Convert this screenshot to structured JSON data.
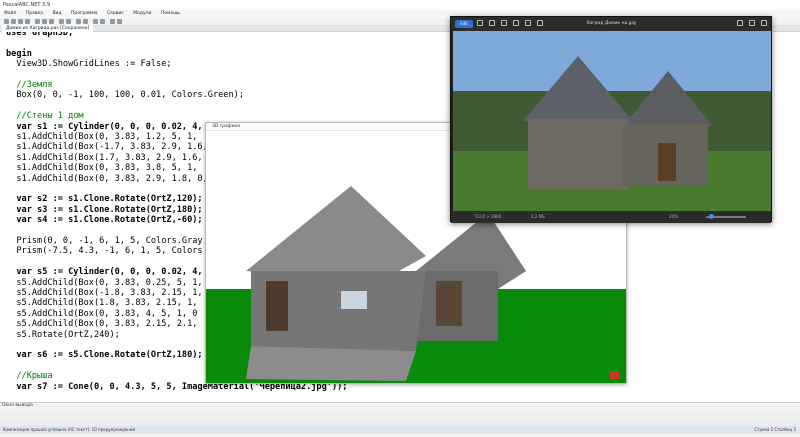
{
  "ide": {
    "title": "PascalABC.NET 3.9",
    "menu": [
      "Файл",
      "Правка",
      "Вид",
      "Программа",
      "Сервис",
      "Модули",
      "Помощь"
    ],
    "file_tab": "Домик из Хагрида.pas [Сохранено]"
  },
  "code": {
    "lines": [
      "uses Graph3D;",
      "",
      "begin",
      "  View3D.ShowGridLines := False;",
      "",
      "  //Земля",
      "  Box(0, 0, -1, 100, 100, 0.01, Colors.Green);",
      "",
      "  //Стены 1 дом",
      "  var s1 := Cylinder(0, 0, 0, 0.02, 4,",
      "  s1.AddChild(Box(0, 3.83, 1.2, 5, 1,",
      "  s1.AddChild(Box(-1.7, 3.83, 2.9, 1.6,",
      "  s1.AddChild(Box(1.7, 3.83, 2.9, 1.6,",
      "  s1.AddChild(Box(0, 3.83, 3.8, 5, 1,",
      "  s1.AddChild(Box(0, 3.83, 2.9, 1.8, 0,",
      "",
      "  var s2 := s1.Clone.Rotate(OrtZ,120);",
      "  var s3 := s1.Clone.Rotate(OrtZ,180);",
      "  var s4 := s1.Clone.Rotate(OrtZ,-60);",
      "",
      "  Prism(0, 0, -1, 6, 1, 5, Colors.Gray",
      "  Prism(-7.5, 4.3, -1, 6, 1, 5, Colors",
      "",
      "  var s5 := Cylinder(0, 0, 0, 0.02, 4,",
      "  s5.AddChild(Box(0, 3.83, 0.25, 5, 1,",
      "  s5.AddChild(Box(-1.8, 3.83, 2.15, 1,",
      "  s5.AddChild(Box(1.8, 3.83, 2.15, 1,",
      "  s5.AddChild(Box(0, 3.83, 4, 5, 1, 0",
      "  s5.AddChild(Box(0, 3.83, 2.15, 2.1,",
      "  s5.Rotate(OrtZ,240);",
      "",
      "  var s6 := s5.Clone.Rotate(OrtZ,180);",
      "",
      "  //Крыша",
      "  var s7 := Cone(0, 0, 4.3, 5, 5, ImageMaterial('Черепица2.jpg'));"
    ]
  },
  "graph_window": {
    "title": "3D графика"
  },
  "photo_viewer": {
    "title": "Хагрид Домик на.jpg",
    "edit_label": "Edit",
    "resolution": "5120 × 2880",
    "file_size": "4,2 МБ",
    "zoom": "20%"
  },
  "bottom": {
    "panel_label": "Окно вывода",
    "tabs": [
      "Окно вывода",
      "Список ошибок",
      "Сообщения компилятора"
    ],
    "status": "Компиляция прошла успешно (0С текст). 10 предупреждений",
    "position": "Строка 1   Столбец 5"
  },
  "colors": {
    "ground": "#0a8a0a",
    "keyword": "#000000",
    "comment": "#008000",
    "accent": "#2f6fd6"
  }
}
